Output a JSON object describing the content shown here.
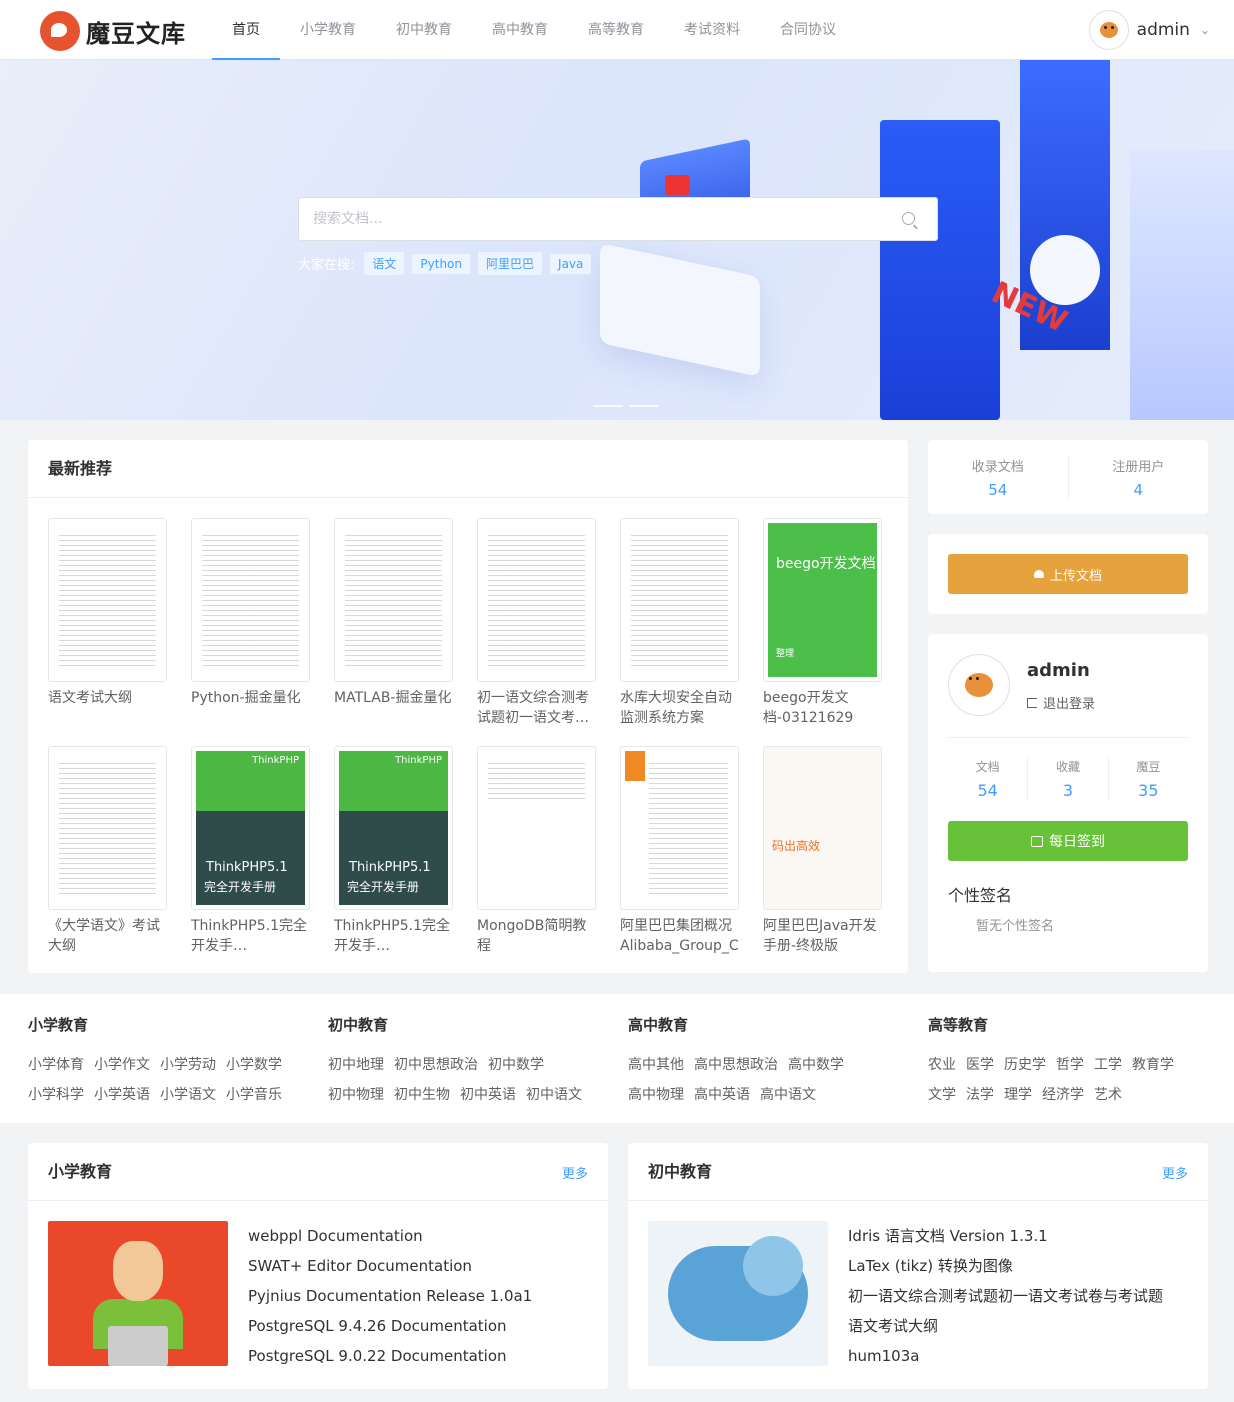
{
  "header": {
    "logo_text": "魔豆文库",
    "nav": [
      "首页",
      "小学教育",
      "初中教育",
      "高中教育",
      "高等教育",
      "考试资料",
      "合同协议"
    ],
    "user_name": "admin"
  },
  "banner": {
    "search_placeholder": "搜索文档...",
    "hot_label": "大家在搜:",
    "hot_tags": [
      "语文",
      "Python",
      "阿里巴巴",
      "Java"
    ],
    "new_text": "NEW"
  },
  "latest": {
    "title": "最新推荐",
    "docs": [
      {
        "title": "语文考试大纲"
      },
      {
        "title": "Python-掘金量化"
      },
      {
        "title": "MATLAB-掘金量化"
      },
      {
        "title": "初一语文综合测考试题初一语文考试卷..."
      },
      {
        "title": "水库大坝安全自动监测系统方案"
      },
      {
        "title": "beego开发文档-03121629",
        "cover_text": "beego开发文档",
        "cover_sub": "整理"
      },
      {
        "title": "《大学语文》考试大纲"
      },
      {
        "title": "ThinkPHP5.1完全开发手册-10261224",
        "cover_brand": "ThinkPHP",
        "cover_ver": "ThinkPHP5.1",
        "cover_sub": "完全开发手册"
      },
      {
        "title": "ThinkPHP5.1完全开发手册-10261224",
        "cover_brand": "ThinkPHP",
        "cover_ver": "ThinkPHP5.1",
        "cover_sub": "完全开发手册"
      },
      {
        "title": "MongoDB简明教程"
      },
      {
        "title": "阿里巴巴集团概况Alibaba_Group_C..."
      },
      {
        "title": "阿里巴巴Java开发手册-终极版",
        "cover_text": "码出高效"
      }
    ]
  },
  "site_stats": {
    "docs_label": "收录文档",
    "docs_value": "54",
    "users_label": "注册用户",
    "users_value": "4"
  },
  "upload": {
    "label": "上传文档"
  },
  "profile": {
    "name": "admin",
    "logout": "退出登录",
    "stats": [
      {
        "label": "文档",
        "value": "54"
      },
      {
        "label": "收藏",
        "value": "3"
      },
      {
        "label": "魔豆",
        "value": "35"
      }
    ],
    "sign_label": "每日签到",
    "signature_title": "个性签名",
    "signature_text": "暂无个性签名"
  },
  "categories": [
    {
      "title": "小学教育",
      "links": [
        "小学体育",
        "小学作文",
        "小学劳动",
        "小学数学",
        "小学科学",
        "小学英语",
        "小学语文",
        "小学音乐"
      ]
    },
    {
      "title": "初中教育",
      "links": [
        "初中地理",
        "初中思想政治",
        "初中数学",
        "初中物理",
        "初中生物",
        "初中英语",
        "初中语文"
      ]
    },
    {
      "title": "高中教育",
      "links": [
        "高中其他",
        "高中思想政治",
        "高中数学",
        "高中物理",
        "高中英语",
        "高中语文"
      ]
    },
    {
      "title": "高等教育",
      "links": [
        "农业",
        "医学",
        "历史学",
        "哲学",
        "工学",
        "教育学",
        "文学",
        "法学",
        "理学",
        "经济学",
        "艺术"
      ]
    }
  ],
  "sections": [
    {
      "title": "小学教育",
      "more": "更多",
      "items": [
        "webppl Documentation",
        "SWAT+ Editor Documentation",
        "Pyjnius Documentation Release 1.0a1",
        "PostgreSQL 9.4.26 Documentation",
        "PostgreSQL 9.0.22 Documentation"
      ]
    },
    {
      "title": "初中教育",
      "more": "更多",
      "items": [
        "Idris 语言文档 Version 1.3.1",
        "LaTex (tikz) 转换为图像",
        "初一语文综合测考试题初一语文考试卷与考试题",
        "语文考试大纲",
        "hum103a"
      ]
    }
  ]
}
